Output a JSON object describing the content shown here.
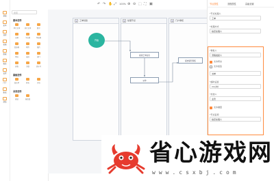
{
  "rail": [
    "基础",
    "表单",
    "流程",
    "权限",
    "数据",
    "报表",
    "设置",
    "门户",
    "集成",
    "帮助"
  ],
  "components": {
    "search_placeholder": "搜索",
    "sections": [
      "基本控件",
      "高级控件",
      "业务控件"
    ],
    "tiles": [
      [
        "单行文本",
        "多行文本",
        "数字"
      ],
      [
        "日期",
        "下拉框",
        "单选框"
      ],
      [
        "复选框",
        "附件",
        "图片"
      ],
      [
        "地址",
        "成员",
        "部门"
      ],
      [
        "表格",
        "关联",
        "流水号"
      ],
      [
        "富文本",
        "签名",
        "定位"
      ],
      [
        "按钮",
        "按钮组"
      ]
    ]
  },
  "toolbar": [
    "↶",
    "↷",
    "✋",
    "⤢",
    "100%",
    "⊕",
    "⊖",
    "⬚",
    "⛶",
    "▣"
  ],
  "lanes": [
    {
      "num": "1",
      "title": "工单创建"
    },
    {
      "num": "2",
      "title": "处理节点"
    },
    {
      "num": "3",
      "title": "门户审核"
    }
  ],
  "nodes": {
    "start": "开始",
    "n1": "提交工单信息",
    "n2": "派单",
    "n3": "提交领导审核"
  },
  "right_panel": {
    "tabs": [
      "节点属性",
      "流程属性",
      "高级设置"
    ],
    "fields": [
      {
        "label": "*节点处理人",
        "value": "工单"
      },
      {
        "label": "*处理方式",
        "value": "指定处理人"
      },
      {
        "label": "*审批人",
        "value": "流程发起人"
      },
      {
        "label": "*节点名称",
        "value": "派单"
      },
      {
        "label": "*超时设置",
        "value": "24小时"
      },
      {
        "label": "*抄送人",
        "value": "主管"
      }
    ],
    "checks": [
      "允许转交",
      "允许加签",
      "允许撤回"
    ]
  },
  "watermark": {
    "title": "省心游戏网",
    "url": "www.csxbj.com"
  },
  "colors": {
    "accent": "#ff8a3d",
    "start_node": "#2bb5a0",
    "tile_icon": "#f6a647",
    "watermark_red": "#e63b2e"
  }
}
